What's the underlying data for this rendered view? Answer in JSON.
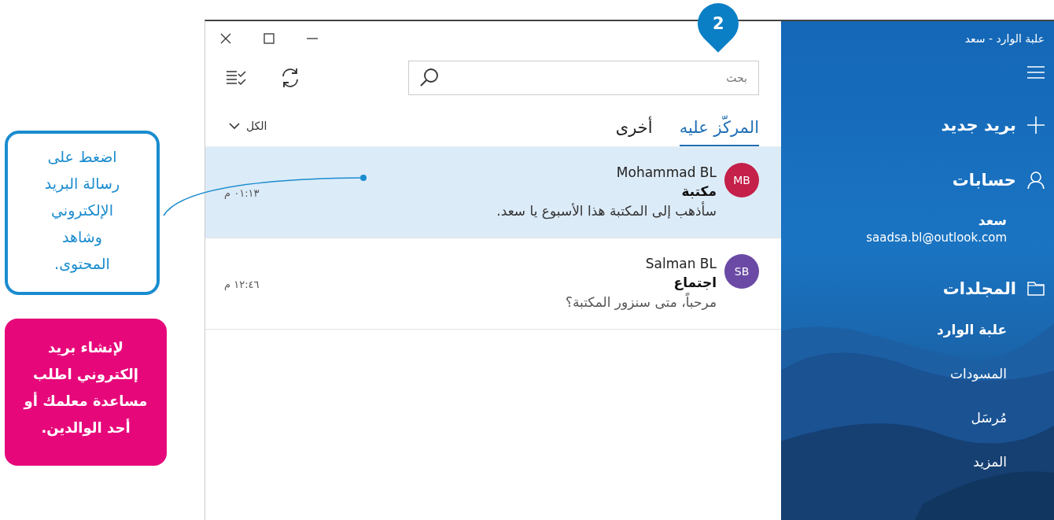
{
  "callouts": [
    {
      "kind": "instruction",
      "text": "اضغط على رسالة البريد الإلكتروني وشاهد المحتوى."
    },
    {
      "kind": "note",
      "text": "لإنشاء بريد إلكتروني اطلب مساعدة معلمك أو أحد الوالدين."
    }
  ],
  "step_badge": "2",
  "search": {
    "placeholder": "بحث"
  },
  "tabs": [
    {
      "label": "المركّز عليه",
      "selected": true
    },
    {
      "label": "أخرى",
      "selected": false
    }
  ],
  "filter": "الكل",
  "messages": [
    {
      "initials": "MB",
      "color": "#c4204a",
      "sender": "Mohammad BL",
      "subject": "مكتبة",
      "preview": "سأذهب إلى المكتبة هذا الأسبوع يا سعد.",
      "time": "٠١:١٣ م",
      "selected": true
    },
    {
      "initials": "SB",
      "color": "#6a4aa5",
      "sender": "Salman BL",
      "subject": "اجتماع",
      "preview": "مرحباً، متى سنزور المكتبة؟",
      "time": "١٢:٤٦ م",
      "selected": false
    }
  ],
  "sidebar": {
    "title": "علبة الوارد - سعد",
    "new_mail": "بريد جديد",
    "accounts_heading": "حسابات",
    "account": {
      "name": "سعد",
      "email": "saadsa.bl@outlook.com"
    },
    "folders_heading": "المجلدات",
    "folders": [
      {
        "label": "علبة الوارد",
        "selected": true
      },
      {
        "label": "المسودات",
        "selected": false
      },
      {
        "label": "مُرسَل",
        "selected": false
      },
      {
        "label": "المزيد",
        "selected": false
      }
    ]
  }
}
